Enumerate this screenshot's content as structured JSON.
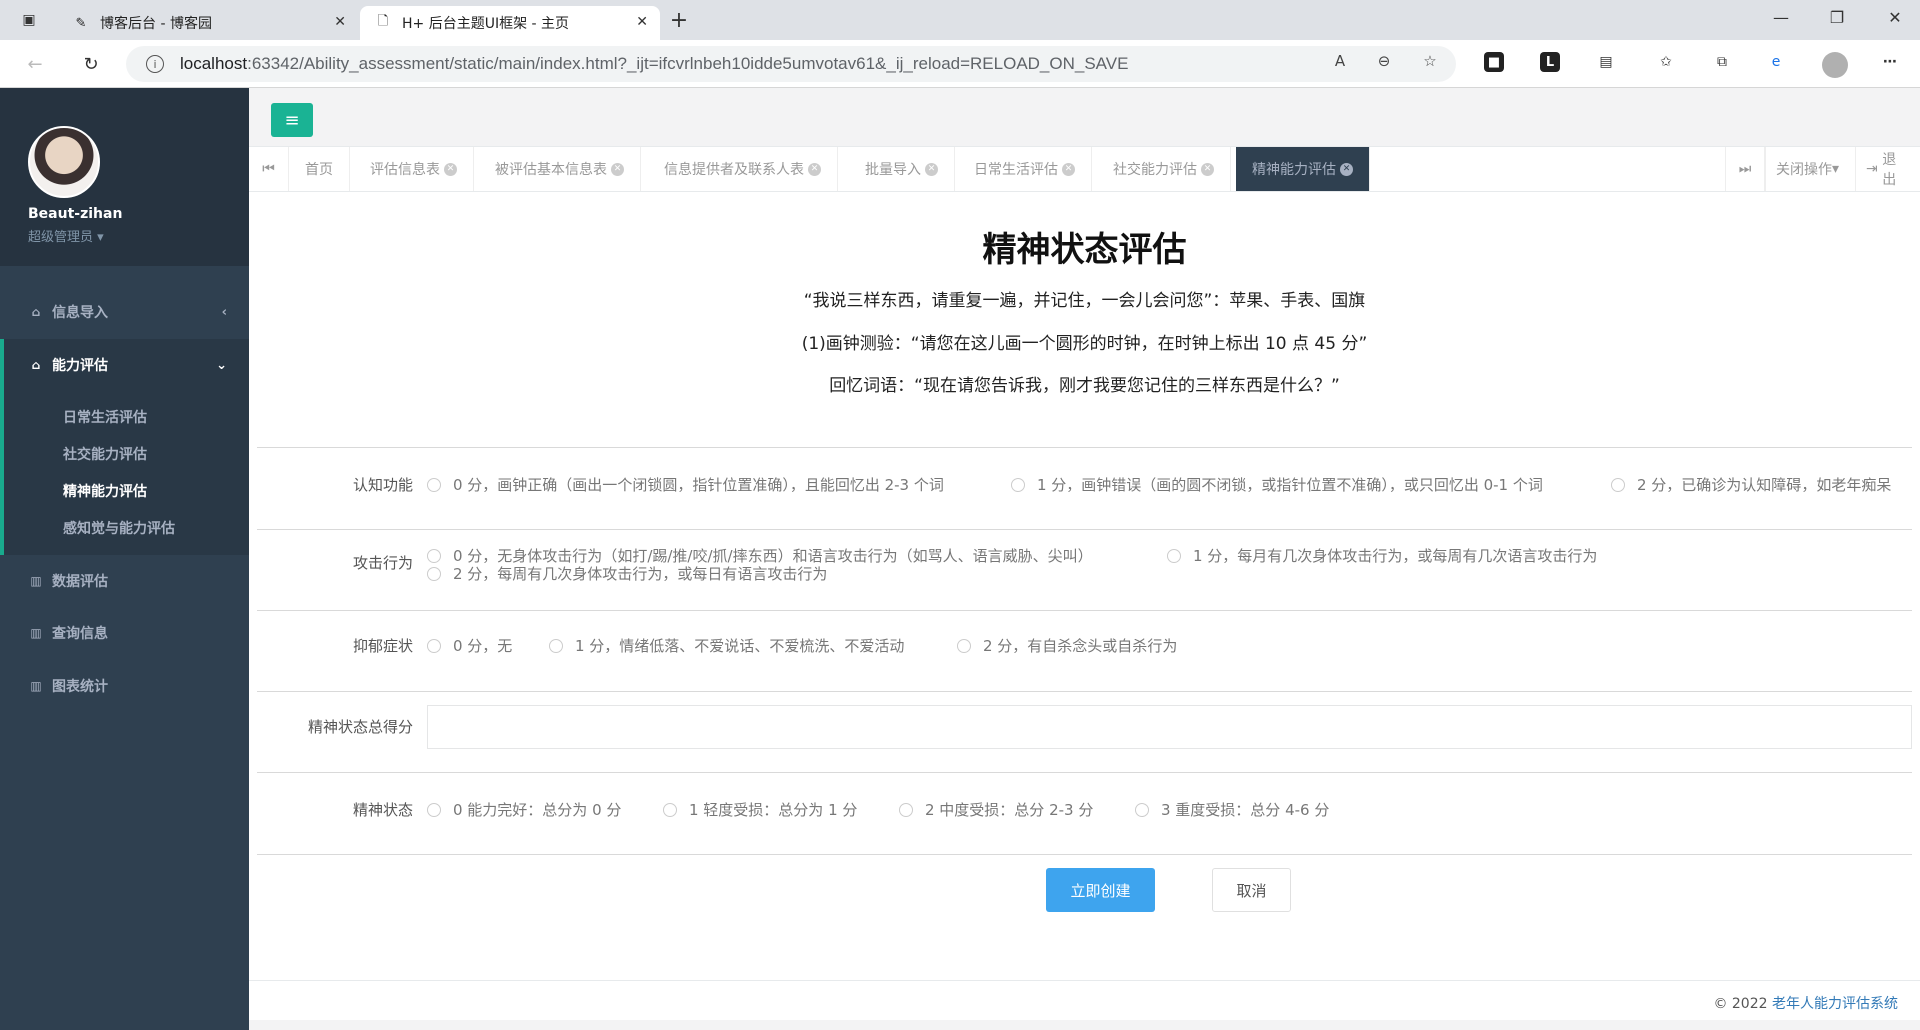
{
  "browser": {
    "tabs": [
      {
        "title": "博客后台 - 博客园",
        "active": false
      },
      {
        "title": "H+ 后台主题UI框架 - 主页",
        "active": true
      }
    ],
    "url_host": "localhost",
    "url_rest": ":63342/Ability_assessment/static/main/index.html?_ijt=ifcvrlnbeh10idde5umvotav61&_ij_reload=RELOAD_ON_SAVE"
  },
  "user": {
    "name": "Beaut-zihan",
    "role": "超级管理员"
  },
  "sidebar": {
    "items": [
      {
        "label": "信息导入"
      },
      {
        "label": "能力评估"
      },
      {
        "label": "数据评估"
      },
      {
        "label": "查询信息"
      },
      {
        "label": "图表统计"
      }
    ],
    "subitems": [
      {
        "label": "日常生活评估"
      },
      {
        "label": "社交能力评估"
      },
      {
        "label": "精神能力评估"
      },
      {
        "label": "感知觉与能力评估"
      }
    ]
  },
  "page_tabs": [
    {
      "label": "首页"
    },
    {
      "label": "评估信息表"
    },
    {
      "label": "被评估基本信息表"
    },
    {
      "label": "信息提供者及联系人表"
    },
    {
      "label": "批量导入"
    },
    {
      "label": "日常生活评估"
    },
    {
      "label": "社交能力评估"
    },
    {
      "label": "精神能力评估"
    }
  ],
  "tab_actions": {
    "close_ops": "关闭操作",
    "logout": "退出"
  },
  "form": {
    "title": "精神状态评估",
    "instructions": [
      "“我说三样东西，请重复一遍，并记住，一会儿会问您”：苹果、手表、国旗",
      "(1)画钟测验：“请您在这儿画一个圆形的时钟，在时钟上标出 10 点 45 分”",
      "回忆词语：“现在请您告诉我，刚才我要您记住的三样东西是什么？”"
    ],
    "cognitive": {
      "label": "认知功能",
      "options": [
        "0 分，画钟正确（画出一个闭锁圆，指针位置准确），且能回忆出 2-3 个词",
        "1 分，画钟错误（画的圆不闭锁，或指针位置不准确），或只回忆出 0-1 个词",
        "2 分，已确诊为认知障碍，如老年痴呆"
      ]
    },
    "aggression": {
      "label": "攻击行为",
      "options": [
        "0 分，无身体攻击行为（如打/踢/推/咬/抓/摔东西）和语言攻击行为（如骂人、语言威胁、尖叫）",
        "1 分，每月有几次身体攻击行为，或每周有几次语言攻击行为",
        "2 分，每周有几次身体攻击行为，或每日有语言攻击行为"
      ]
    },
    "depression": {
      "label": "抑郁症状",
      "options": [
        "0 分，无",
        "1 分，情绪低落、不爱说话、不爱梳洗、不爱活动",
        "2 分，有自杀念头或自杀行为"
      ]
    },
    "total": {
      "label": "精神状态总得分",
      "value": ""
    },
    "status": {
      "label": "精神状态",
      "options": [
        "0 能力完好：总分为 0 分",
        "1 轻度受损：总分为 1 分",
        "2 中度受损：总分 2-3 分",
        "3 重度受损：总分 4-6 分"
      ]
    },
    "submit": "立即创建",
    "cancel": "取消"
  },
  "footer": {
    "copyright": "© 2022",
    "system": "老年人能力评估系统"
  }
}
